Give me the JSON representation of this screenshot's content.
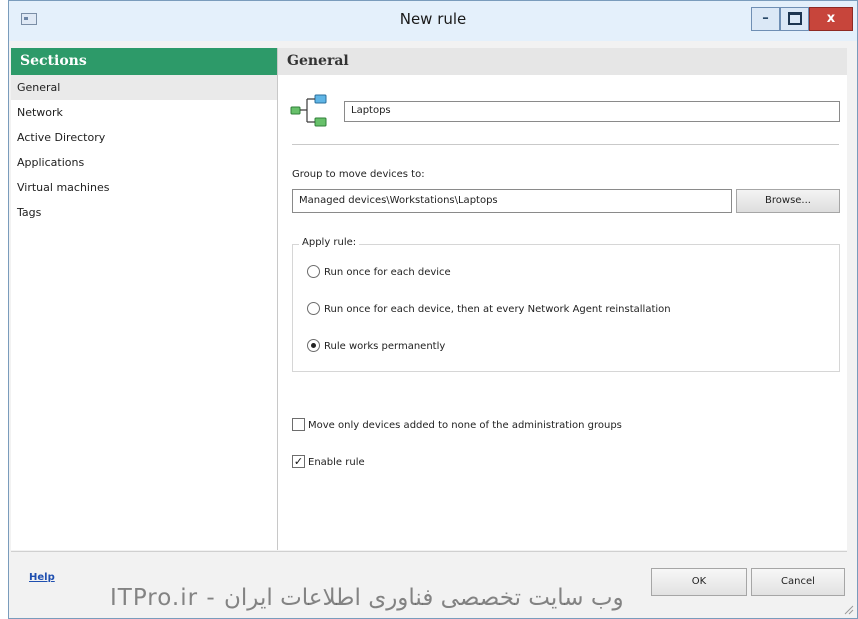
{
  "window": {
    "title": "New rule"
  },
  "sidebar": {
    "header": "Sections",
    "items": [
      {
        "label": "General",
        "active": true
      },
      {
        "label": "Network"
      },
      {
        "label": "Active Directory"
      },
      {
        "label": "Applications"
      },
      {
        "label": "Virtual machines"
      },
      {
        "label": "Tags"
      }
    ]
  },
  "main": {
    "header": "General",
    "rule_name_value": "Laptops",
    "group_label": "Group to move devices to:",
    "group_value": "Managed devices\\Workstations\\Laptops",
    "browse_label": "Browse...",
    "apply_rule": {
      "legend": "Apply rule:",
      "options": [
        {
          "label": "Run once for each device",
          "selected": false
        },
        {
          "label": "Run once for each device, then at every Network Agent reinstallation",
          "selected": false
        },
        {
          "label": "Rule works permanently",
          "selected": true
        }
      ]
    },
    "move_only_label": "Move only devices added to none of the administration groups",
    "move_only_checked": false,
    "enable_rule_label": "Enable rule",
    "enable_rule_checked": true
  },
  "footer": {
    "help": "Help",
    "ok": "OK",
    "cancel": "Cancel"
  },
  "watermark": "ITPro.ir - وب سایت تخصصی فناوری اطلاعات ایران",
  "colors": {
    "accent": "#2d9a69",
    "close": "#c7453b",
    "titlebar": "#e4f0fb"
  }
}
